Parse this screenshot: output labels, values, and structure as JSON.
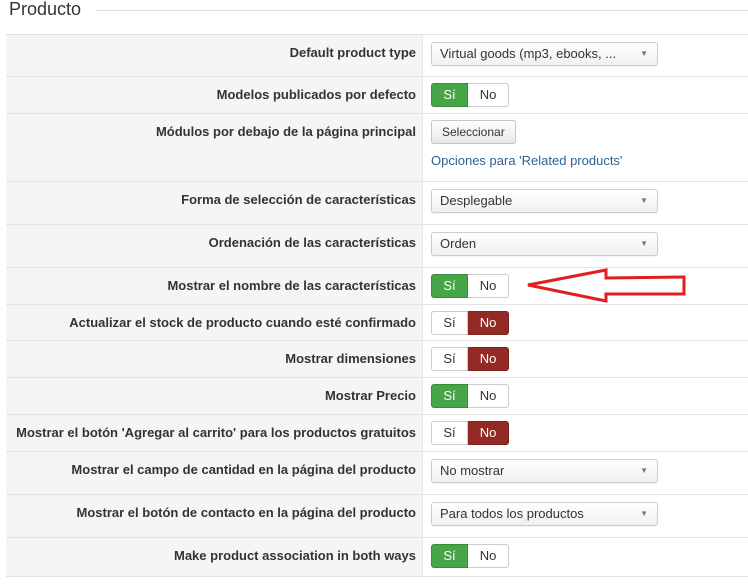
{
  "section_title": "Producto",
  "rows": [
    {
      "label": "Default product type",
      "type": "select",
      "value": "Virtual goods (mp3, ebooks, ..."
    },
    {
      "label": "Modelos publicados por defecto",
      "type": "toggle",
      "yes": "Sí",
      "no": "No",
      "selected": "yes"
    },
    {
      "label": "Módulos por debajo de la página principal",
      "type": "button",
      "button": "Seleccionar",
      "link": "Opciones para 'Related products'"
    },
    {
      "label": "Forma de selección de características",
      "type": "select",
      "value": "Desplegable"
    },
    {
      "label": "Ordenación de las características",
      "type": "select",
      "value": "Orden"
    },
    {
      "label": "Mostrar el nombre de las características",
      "type": "toggle",
      "yes": "Sí",
      "no": "No",
      "selected": "yes"
    },
    {
      "label": "Actualizar el stock de producto cuando esté confirmado",
      "type": "toggle",
      "yes": "Sí",
      "no": "No",
      "selected": "no"
    },
    {
      "label": "Mostrar dimensiones",
      "type": "toggle",
      "yes": "Sí",
      "no": "No",
      "selected": "no"
    },
    {
      "label": "Mostrar Precio",
      "type": "toggle",
      "yes": "Sí",
      "no": "No",
      "selected": "yes"
    },
    {
      "label": "Mostrar el botón 'Agregar al carrito' para los productos gratuitos",
      "type": "toggle",
      "yes": "Sí",
      "no": "No",
      "selected": "no"
    },
    {
      "label": "Mostrar el campo de cantidad en la página del producto",
      "type": "select",
      "value": "No mostrar"
    },
    {
      "label": "Mostrar el botón de contacto en la página del producto",
      "type": "select",
      "value": "Para todos los productos"
    },
    {
      "label": "Make product association in both ways",
      "type": "toggle",
      "yes": "Sí",
      "no": "No",
      "selected": "yes"
    }
  ],
  "colors": {
    "yes_active": "#46a546",
    "no_active": "#942a25",
    "annotation_arrow": "#e02020"
  },
  "annotation": {
    "icon": "red-arrow-icon",
    "points_to_row": 5
  }
}
